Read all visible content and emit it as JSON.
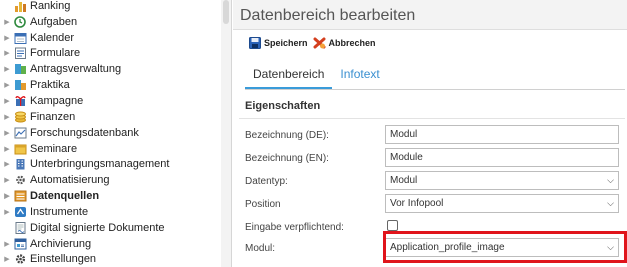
{
  "sidebar": {
    "items": [
      {
        "label": "Ranking",
        "icon": "ranking-icon",
        "expandable": false,
        "active": false
      },
      {
        "label": "Aufgaben",
        "icon": "tasks-icon",
        "expandable": true,
        "active": false
      },
      {
        "label": "Kalender",
        "icon": "calendar-icon",
        "expandable": true,
        "active": false
      },
      {
        "label": "Formulare",
        "icon": "forms-icon",
        "expandable": true,
        "active": false
      },
      {
        "label": "Antragsverwaltung",
        "icon": "applications-icon",
        "expandable": true,
        "active": false
      },
      {
        "label": "Praktika",
        "icon": "internship-icon",
        "expandable": true,
        "active": false
      },
      {
        "label": "Kampagne",
        "icon": "campaign-icon",
        "expandable": true,
        "active": false
      },
      {
        "label": "Finanzen",
        "icon": "finance-icon",
        "expandable": true,
        "active": false
      },
      {
        "label": "Forschungsdatenbank",
        "icon": "research-database-icon",
        "expandable": true,
        "active": false
      },
      {
        "label": "Seminare",
        "icon": "seminars-icon",
        "expandable": true,
        "active": false
      },
      {
        "label": "Unterbringungsmanagement",
        "icon": "accommodation-icon",
        "expandable": true,
        "active": false
      },
      {
        "label": "Automatisierung",
        "icon": "automation-icon",
        "expandable": true,
        "active": false
      },
      {
        "label": "Datenquellen",
        "icon": "data-sources-icon",
        "expandable": true,
        "active": true
      },
      {
        "label": "Instrumente",
        "icon": "instruments-icon",
        "expandable": true,
        "active": false
      },
      {
        "label": "Digital signierte Dokumente",
        "icon": "signed-documents-icon",
        "expandable": false,
        "active": false
      },
      {
        "label": "Archivierung",
        "icon": "archive-icon",
        "expandable": true,
        "active": false
      },
      {
        "label": "Einstellungen",
        "icon": "settings-icon",
        "expandable": true,
        "active": false
      }
    ]
  },
  "main": {
    "title": "Datenbereich bearbeiten",
    "toolbar": {
      "save_label": "Speichern",
      "cancel_label": "Abbrechen"
    },
    "tabs": [
      {
        "label": "Datenbereich",
        "active": true
      },
      {
        "label": "Infotext",
        "active": false
      }
    ],
    "section_title": "Eigenschaften",
    "fields": {
      "name_de": {
        "label": "Bezeichnung (DE):",
        "value": "Modul"
      },
      "name_en": {
        "label": "Bezeichnung (EN):",
        "value": "Module"
      },
      "datatype": {
        "label": "Datentyp:",
        "value": "Modul"
      },
      "position": {
        "label": "Position",
        "value": "Vor Infopool"
      },
      "required": {
        "label": "Eingabe verpflichtend:",
        "checked": false
      },
      "module": {
        "label": "Modul:",
        "value": "Application_profile_image"
      }
    }
  },
  "colors": {
    "highlight": "#e0141b",
    "tab_accent": "#3a9bd9",
    "link": "#3a8fd0"
  }
}
